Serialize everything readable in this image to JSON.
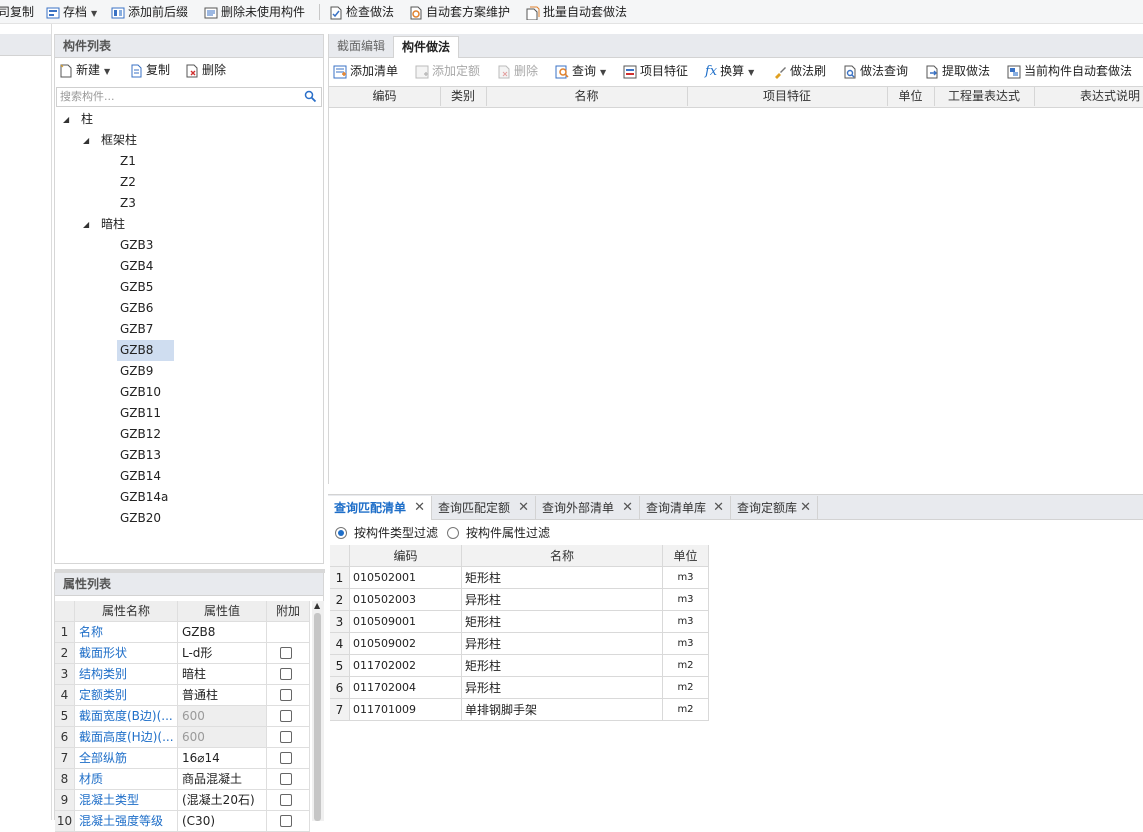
{
  "toolbar": {
    "items": [
      {
        "label": "司复制",
        "icon": "copy-icon"
      },
      {
        "label": "存档",
        "icon": "archive-icon",
        "has_dropdown": true
      },
      {
        "label": "添加前后缀",
        "icon": "add-prefix-icon"
      },
      {
        "label": "删除未使用构件",
        "icon": "delete-unused-icon"
      },
      {
        "label": "检查做法",
        "icon": "check-method-icon"
      },
      {
        "label": "自动套方案维护",
        "icon": "auto-scheme-icon"
      },
      {
        "label": "批量自动套做法",
        "icon": "batch-auto-icon"
      }
    ]
  },
  "component_list": {
    "title": "构件列表",
    "tools": [
      {
        "label": "新建",
        "icon": "new-icon",
        "has_dropdown": true
      },
      {
        "label": "复制",
        "icon": "copy-icon"
      },
      {
        "label": "删除",
        "icon": "delete-icon"
      }
    ],
    "search_placeholder": "搜索构件...",
    "tree": [
      {
        "label": "柱",
        "level": 0,
        "expanded": true
      },
      {
        "label": "框架柱",
        "level": 1,
        "expanded": true
      },
      {
        "label": "Z1",
        "level": 2
      },
      {
        "label": "Z2",
        "level": 2
      },
      {
        "label": "Z3",
        "level": 2
      },
      {
        "label": "暗柱",
        "level": 1,
        "expanded": true
      },
      {
        "label": "GZB3",
        "level": 2
      },
      {
        "label": "GZB4",
        "level": 2
      },
      {
        "label": "GZB5",
        "level": 2
      },
      {
        "label": "GZB6",
        "level": 2
      },
      {
        "label": "GZB7",
        "level": 2
      },
      {
        "label": "GZB8",
        "level": 2,
        "selected": true
      },
      {
        "label": "GZB9",
        "level": 2
      },
      {
        "label": "GZB10",
        "level": 2
      },
      {
        "label": "GZB11",
        "level": 2
      },
      {
        "label": "GZB12",
        "level": 2
      },
      {
        "label": "GZB13",
        "level": 2
      },
      {
        "label": "GZB14",
        "level": 2
      },
      {
        "label": "GZB14a",
        "level": 2
      },
      {
        "label": "GZB20",
        "level": 2
      }
    ]
  },
  "property_list": {
    "title": "属性列表",
    "columns": [
      "属性名称",
      "属性值",
      "附加"
    ],
    "rows": [
      {
        "num": "1",
        "name": "名称",
        "value": "GZB8",
        "checkbox": false,
        "readonly": false
      },
      {
        "num": "2",
        "name": "截面形状",
        "value": "L-d形",
        "checkbox": true,
        "readonly": false
      },
      {
        "num": "3",
        "name": "结构类别",
        "value": "暗柱",
        "checkbox": true,
        "readonly": false
      },
      {
        "num": "4",
        "name": "定额类别",
        "value": "普通柱",
        "checkbox": true,
        "readonly": false
      },
      {
        "num": "5",
        "name": "截面宽度(B边)(...",
        "value": "600",
        "checkbox": true,
        "readonly": true
      },
      {
        "num": "6",
        "name": "截面高度(H边)(...",
        "value": "600",
        "checkbox": true,
        "readonly": true
      },
      {
        "num": "7",
        "name": "全部纵筋",
        "value": "16⌀14",
        "checkbox": true,
        "readonly": false
      },
      {
        "num": "8",
        "name": "材质",
        "value": "商品混凝土",
        "checkbox": true,
        "readonly": false
      },
      {
        "num": "9",
        "name": "混凝土类型",
        "value": "(混凝土20石)",
        "checkbox": true,
        "readonly": false
      },
      {
        "num": "10",
        "name": "混凝土强度等级",
        "value": "(C30)",
        "checkbox": true,
        "readonly": false
      }
    ]
  },
  "method_panel": {
    "tabs": [
      {
        "label": "截面编辑",
        "active": false
      },
      {
        "label": "构件做法",
        "active": true
      }
    ],
    "tools": [
      {
        "label": "添加清单",
        "icon": "add-list-icon",
        "disabled": false
      },
      {
        "label": "添加定额",
        "icon": "add-quota-icon",
        "disabled": true
      },
      {
        "label": "删除",
        "icon": "delete-icon",
        "disabled": true
      },
      {
        "label": "查询",
        "icon": "query-icon",
        "disabled": false,
        "has_dropdown": true
      },
      {
        "label": "项目特征",
        "icon": "feature-icon",
        "disabled": false
      },
      {
        "label": "换算",
        "icon": "fx-icon",
        "disabled": false,
        "has_dropdown": true
      },
      {
        "label": "做法刷",
        "icon": "brush-icon",
        "disabled": false
      },
      {
        "label": "做法查询",
        "icon": "method-query-icon",
        "disabled": false
      },
      {
        "label": "提取做法",
        "icon": "extract-icon",
        "disabled": false
      },
      {
        "label": "当前构件自动套做法",
        "icon": "auto-apply-icon",
        "disabled": false
      }
    ],
    "columns": [
      "编码",
      "类别",
      "名称",
      "项目特征",
      "单位",
      "工程量表达式",
      "表达式说明"
    ]
  },
  "query_panel": {
    "tabs": [
      {
        "label": "查询匹配清单",
        "active": true
      },
      {
        "label": "查询匹配定额",
        "active": false
      },
      {
        "label": "查询外部清单",
        "active": false
      },
      {
        "label": "查询清单库",
        "active": false
      },
      {
        "label": "查询定额库",
        "active": false
      }
    ],
    "filters": [
      {
        "label": "按构件类型过滤",
        "selected": true
      },
      {
        "label": "按构件属性过滤",
        "selected": false
      }
    ],
    "columns": [
      "编码",
      "名称",
      "单位"
    ],
    "rows": [
      {
        "num": "1",
        "code": "010502001",
        "name": "矩形柱",
        "unit": "m3"
      },
      {
        "num": "2",
        "code": "010502003",
        "name": "异形柱",
        "unit": "m3"
      },
      {
        "num": "3",
        "code": "010509001",
        "name": "矩形柱",
        "unit": "m3"
      },
      {
        "num": "4",
        "code": "010509002",
        "name": "异形柱",
        "unit": "m3"
      },
      {
        "num": "5",
        "code": "011702002",
        "name": "矩形柱",
        "unit": "m2"
      },
      {
        "num": "6",
        "code": "011702004",
        "name": "异形柱",
        "unit": "m2"
      },
      {
        "num": "7",
        "code": "011701009",
        "name": "单排钢脚手架",
        "unit": "m2"
      }
    ]
  },
  "colors": {
    "accent": "#1e6ec8",
    "selection": "#cfddf0",
    "header_bg": "#e8eaee"
  }
}
